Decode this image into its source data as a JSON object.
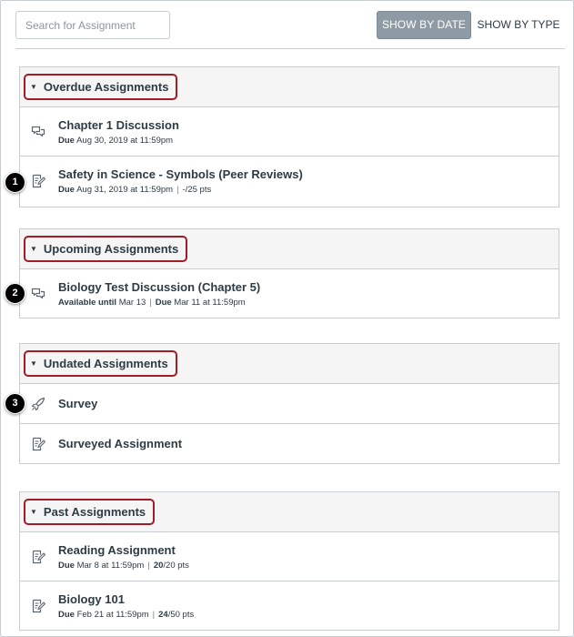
{
  "toolbar": {
    "search_placeholder": "Search for Assignment",
    "show_by_date": "SHOW BY DATE",
    "show_by_type": "SHOW BY TYPE"
  },
  "groups": [
    {
      "label": "Overdue Assignments",
      "items": [
        {
          "title": "Chapter 1 Discussion",
          "icon": "discussion-icon",
          "meta_label": "Due",
          "meta_value": "Aug 30, 2019 at 11:59pm"
        },
        {
          "title": "Safety in Science - Symbols (Peer Reviews)",
          "icon": "assignment-icon",
          "meta_label": "Due",
          "meta_value": "Aug 31, 2019 at 11:59pm",
          "score": "-/25 pts"
        }
      ]
    },
    {
      "label": "Upcoming Assignments",
      "items": [
        {
          "title": "Biology Test Discussion (Chapter 5)",
          "icon": "discussion-icon",
          "avail_label": "Available until",
          "avail_value": "Mar 13",
          "meta_label": "Due",
          "meta_value": "Mar 11 at 11:59pm"
        }
      ]
    },
    {
      "label": "Undated Assignments",
      "items": [
        {
          "title": "Survey",
          "icon": "survey-rocket-icon"
        },
        {
          "title": "Surveyed Assignment",
          "icon": "assignment-icon"
        }
      ]
    },
    {
      "label": "Past Assignments",
      "items": [
        {
          "title": "Reading Assignment",
          "icon": "assignment-icon",
          "meta_label": "Due",
          "meta_value": "Mar 8 at 11:59pm",
          "score_earned": "20",
          "score_total": "/20 pts"
        },
        {
          "title": "Biology 101",
          "icon": "assignment-icon",
          "meta_label": "Due",
          "meta_value": "Feb 21 at 11:59pm",
          "score_earned": "24",
          "score_total": "/50 pts"
        }
      ]
    }
  ],
  "callouts": [
    "1",
    "2",
    "3"
  ],
  "colors": {
    "header_outline": "#a01c26",
    "active_button": "#8f9ba4",
    "text": "#2d3b45",
    "border": "#c7cdd1"
  }
}
